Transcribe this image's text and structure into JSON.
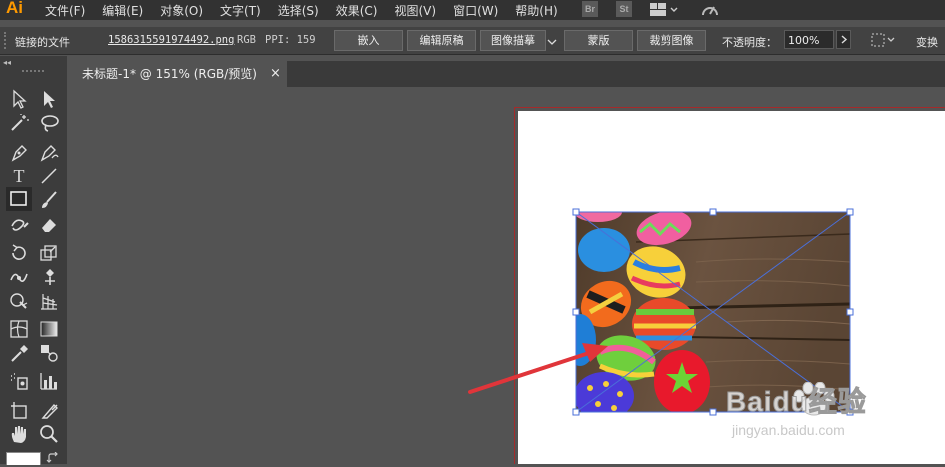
{
  "app": {
    "logo": "Ai"
  },
  "menubar": {
    "items": [
      "文件(F)",
      "编辑(E)",
      "对象(O)",
      "文字(T)",
      "选择(S)",
      "效果(C)",
      "视图(V)",
      "窗口(W)",
      "帮助(H)"
    ],
    "app_buttons": [
      "Br",
      "St"
    ]
  },
  "control_bar": {
    "linked_file_label": "链接的文件",
    "filename": "1586315591974492.png",
    "color_mode": "RGB",
    "ppi_label": "PPI: 159",
    "embed_button": "嵌入",
    "edit_original_button": "编辑原稿",
    "image_trace_button": "图像描摹",
    "mask_button": "蒙版",
    "crop_button": "裁剪图像",
    "opacity_label": "不透明度：",
    "opacity_value": "100%",
    "transform_label": "变换"
  },
  "document_tab": {
    "title": "未标题-1* @ 151% (RGB/预览)",
    "close": "×"
  },
  "watermark": {
    "brand": "Baidu经验",
    "url": "jingyan.baidu.com"
  },
  "colors": {
    "menubar_bg": "#323232",
    "panel_bg": "#3c3c3c",
    "canvas_bg": "#535353",
    "artboard_border": "#a52a2a",
    "selection": "#4a6fd8",
    "arrow": "#e0353a"
  }
}
